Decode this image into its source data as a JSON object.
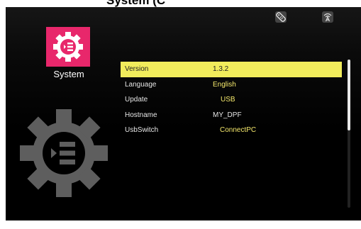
{
  "header": {
    "partial_title": "System (C"
  },
  "status": {
    "icon1": "remote-icon",
    "icon2": "wifi-icon"
  },
  "app": {
    "name": "System",
    "icon": "settings-gear-icon",
    "accent": "#e8276b"
  },
  "settings": [
    {
      "label": "Version",
      "value": "1.3.2",
      "selected": true
    },
    {
      "label": "Language",
      "value": "English",
      "selected": false
    },
    {
      "label": "Update",
      "value": "USB",
      "selected": false
    },
    {
      "label": "Hostname",
      "value": "MY_DPF",
      "selected": false
    },
    {
      "label": "UsbSwitch",
      "value": "ConnectPC",
      "selected": false
    }
  ],
  "colors": {
    "highlight": "#f1ec5c",
    "value_text": "#f5e86c",
    "background": "#000000"
  }
}
